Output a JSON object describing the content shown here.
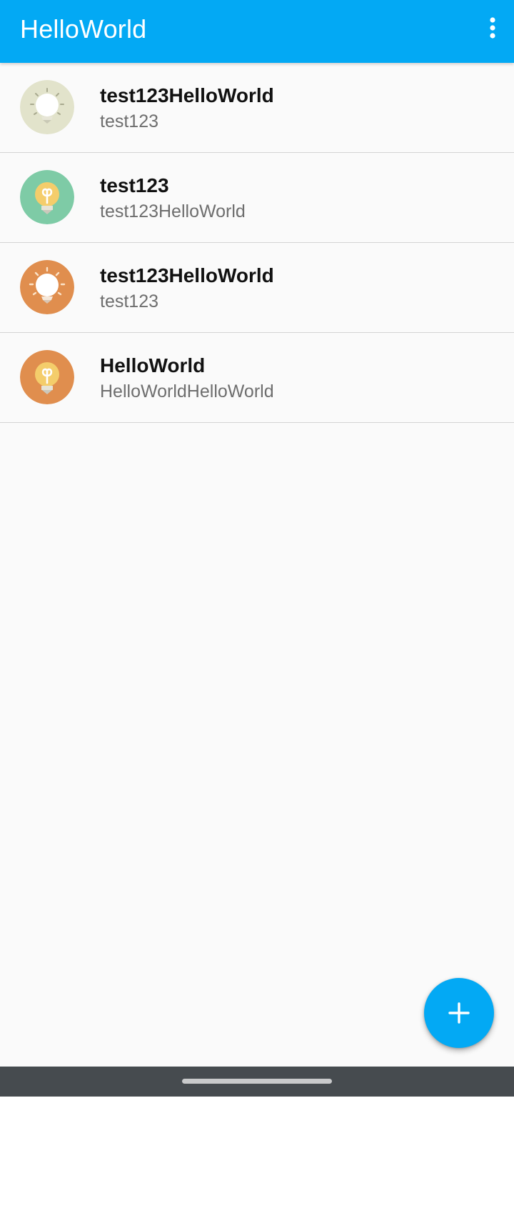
{
  "app_bar": {
    "title": "HelloWorld",
    "menu_icon": "more-vert-icon"
  },
  "notes": [
    {
      "title": "test123HelloWorld",
      "subtitle": "test123",
      "icon": "lightbulb-on-icon",
      "icon_bg": "#e2e3cb"
    },
    {
      "title": "test123",
      "subtitle": "test123HelloWorld",
      "icon": "lightbulb-off-icon",
      "icon_bg": "#7ecba6"
    },
    {
      "title": "test123HelloWorld",
      "subtitle": "test123",
      "icon": "lightbulb-on-icon",
      "icon_bg": "#e08e4e"
    },
    {
      "title": "HelloWorld",
      "subtitle": "HelloWorldHelloWorld",
      "icon": "lightbulb-off-icon",
      "icon_bg": "#e08e4e"
    }
  ],
  "fab": {
    "icon": "plus-icon"
  },
  "nav_bar": {
    "handle": "home-handle"
  },
  "colors": {
    "primary": "#03a9f4",
    "background": "#fafafa",
    "divider": "#d4d4d4",
    "nav_bar": "#464b4f"
  }
}
